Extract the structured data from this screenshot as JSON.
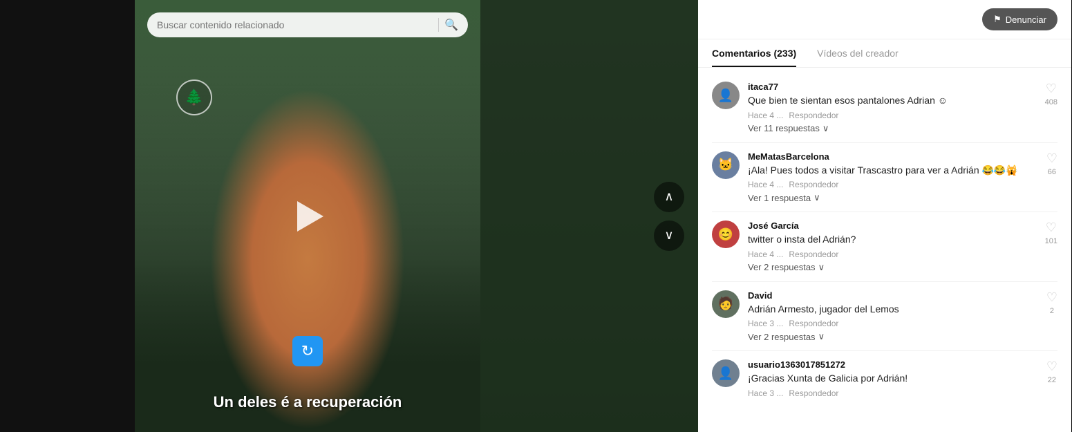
{
  "search": {
    "placeholder": "Buscar contenido relacionado"
  },
  "video": {
    "subtitle": "Un deles é a recuperación",
    "tree_icon": "🌲",
    "replay_icon": "↻"
  },
  "header": {
    "report_label": "Denunciar"
  },
  "tabs": [
    {
      "id": "comments",
      "label": "Comentarios (233)",
      "active": true
    },
    {
      "id": "creator_videos",
      "label": "Vídeos del creador",
      "active": false
    }
  ],
  "comments": [
    {
      "id": "c1",
      "username": "itaca77",
      "text": "Que bien te sientan esos pantalones Adrian ☺",
      "time": "Hace 4 ...",
      "responder": "Respondedor",
      "likes": 408,
      "replies_label": "Ver 11 respuestas",
      "avatar_emoji": "👤"
    },
    {
      "id": "c2",
      "username": "MeMatasBarcelona",
      "text": "¡Ala! Pues todos a visitar Trascastro para ver a Adrián 😂😂🙀",
      "time": "Hace 4 ...",
      "responder": "Respondedor",
      "likes": 66,
      "replies_label": "Ver 1 respuesta",
      "avatar_emoji": "🐱"
    },
    {
      "id": "c3",
      "username": "José García",
      "text": "twitter o insta del Adrián?",
      "time": "Hace 4 ...",
      "responder": "Respondedor",
      "likes": 101,
      "replies_label": "Ver 2 respuestas",
      "avatar_emoji": "😊"
    },
    {
      "id": "c4",
      "username": "David",
      "text": "Adrián Armesto, jugador del Lemos",
      "time": "Hace 3 ...",
      "responder": "Respondedor",
      "likes": 2,
      "replies_label": "Ver 2 respuestas",
      "avatar_emoji": "🧑"
    },
    {
      "id": "c5",
      "username": "usuario1363017851272",
      "text": "¡Gracias Xunta de Galicia por Adrián!",
      "time": "Hace 3 ...",
      "responder": "Respondedor",
      "likes": 22,
      "replies_label": "",
      "avatar_emoji": "👤"
    }
  ],
  "nav": {
    "up_arrow": "∧",
    "down_arrow": "∨"
  }
}
